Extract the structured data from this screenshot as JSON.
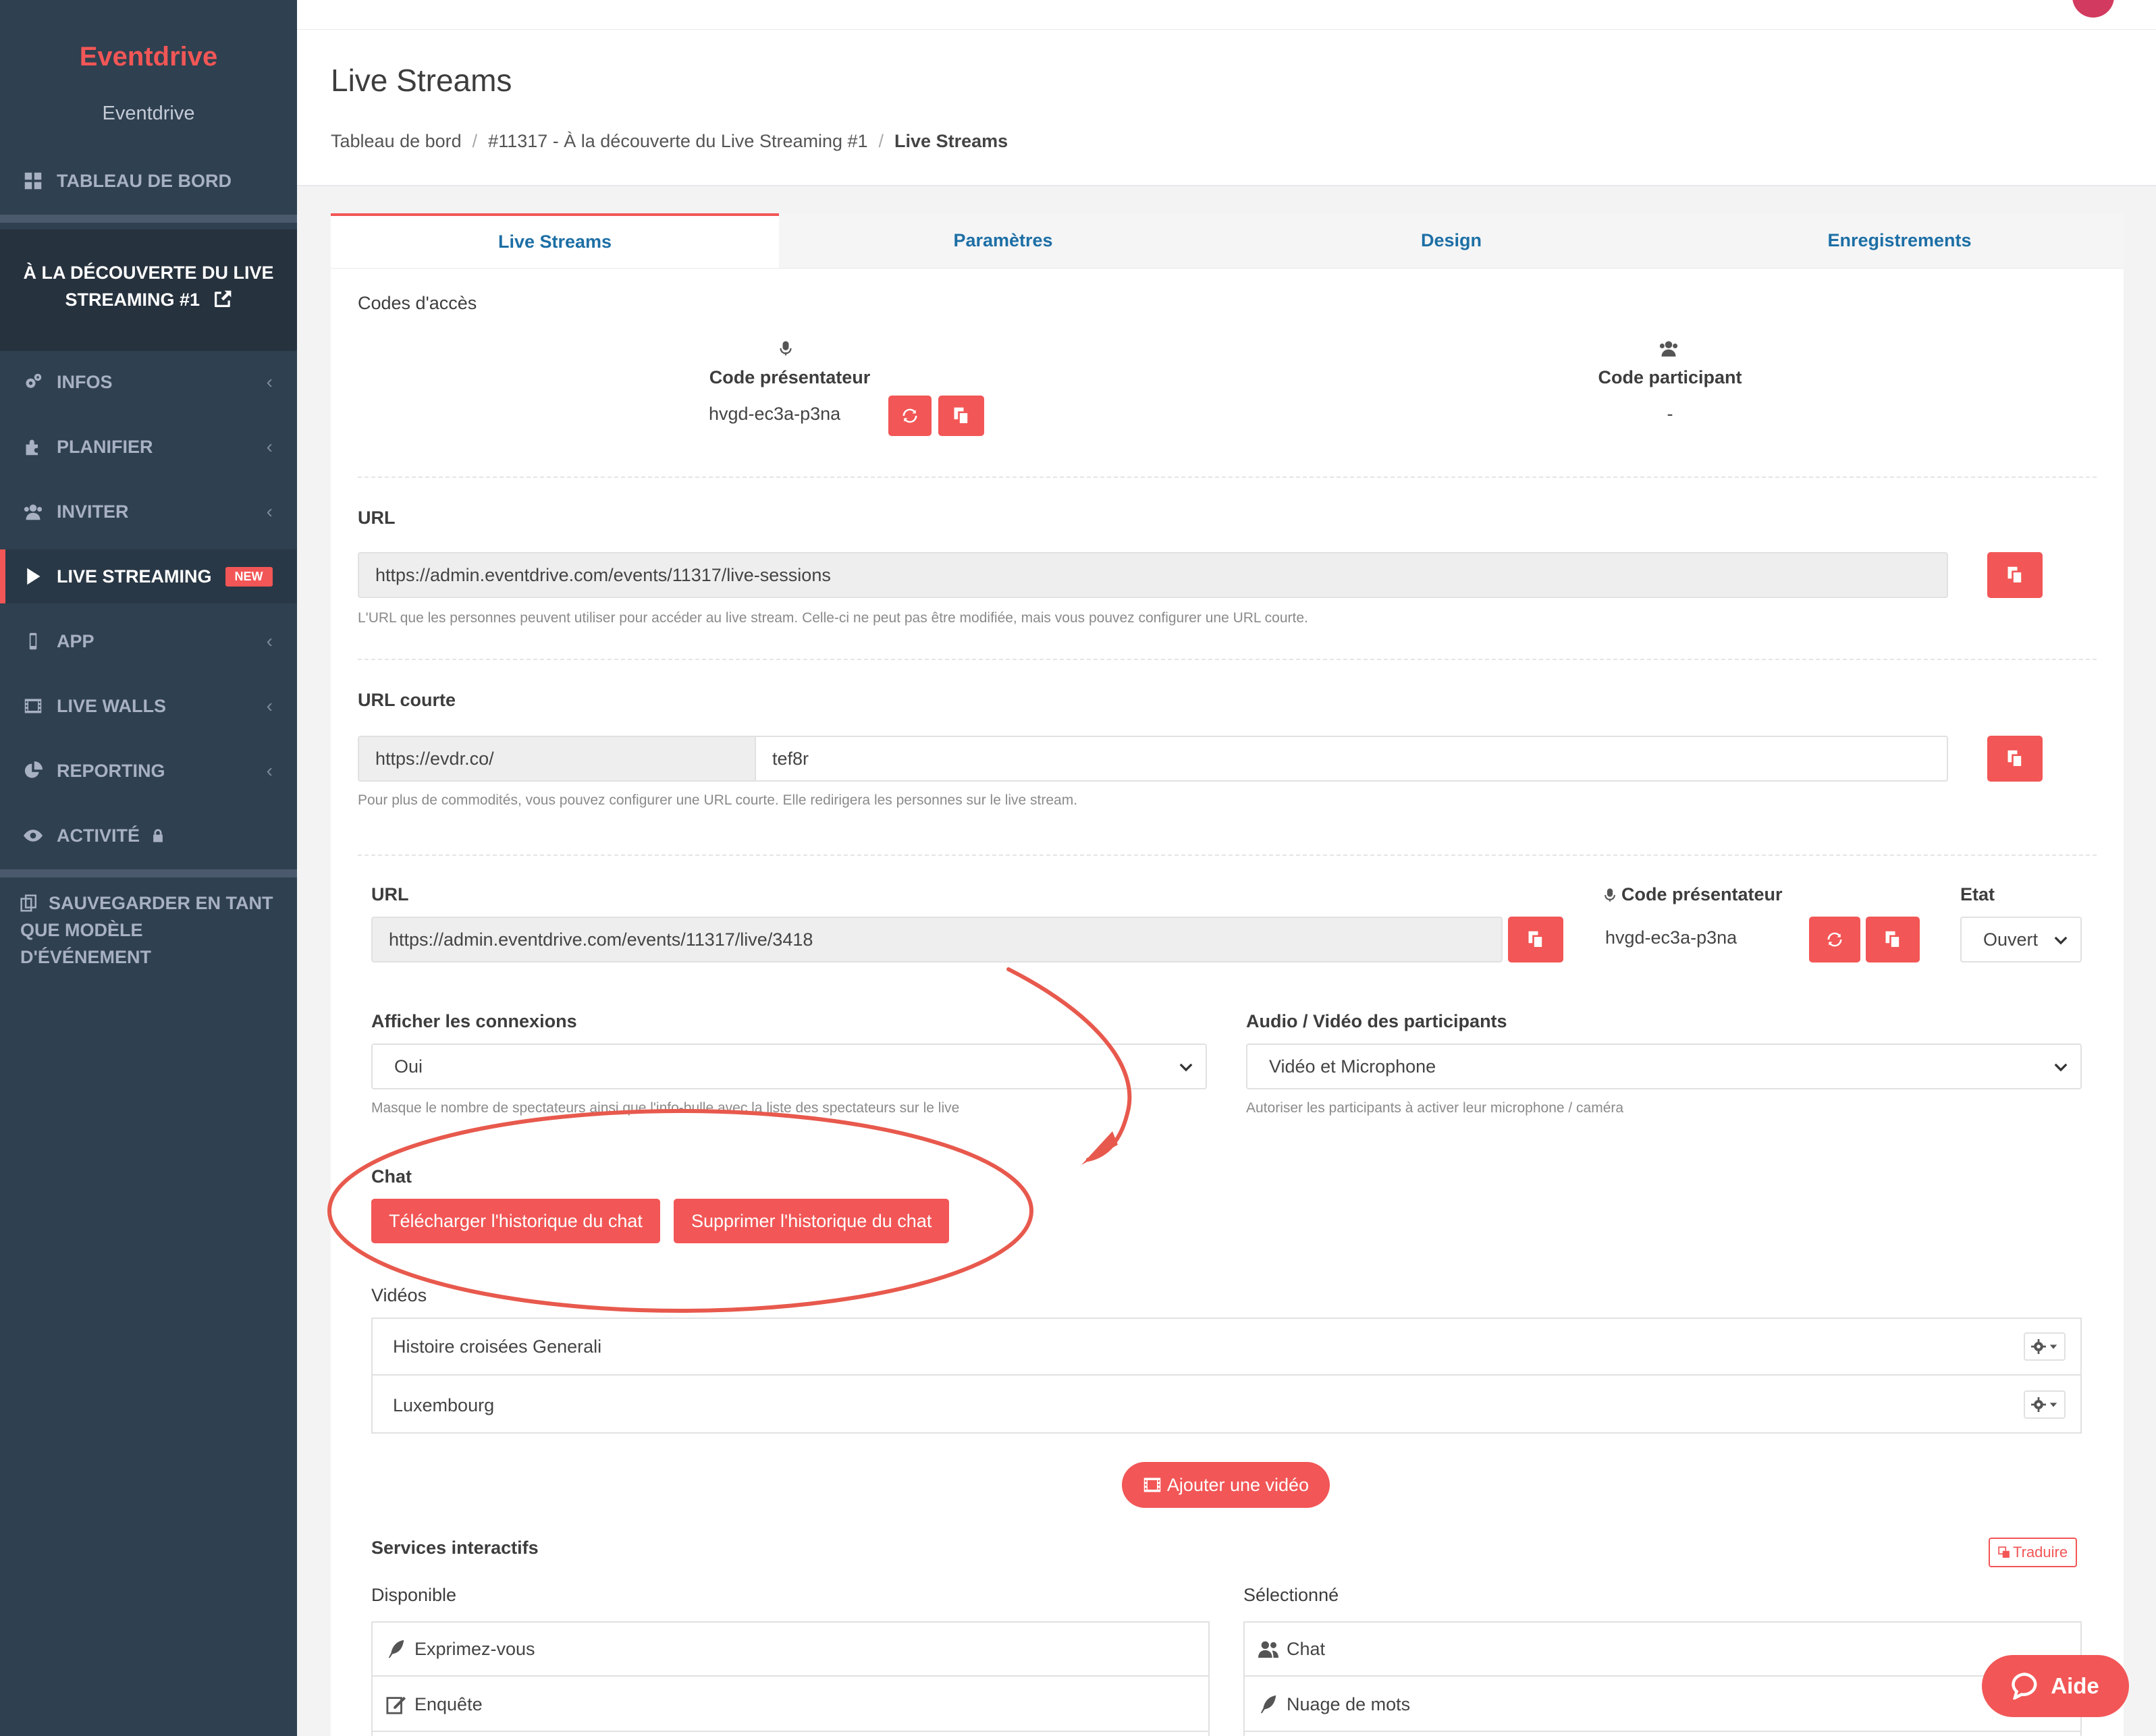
{
  "sidebar": {
    "brand": "Eventdrive",
    "org_name": "Eventdrive",
    "dashboard": "TABLEAU DE BORD",
    "event_title_line1": "À LA DÉCOUVERTE DU LIVE",
    "event_title_line2": "STREAMING #1",
    "items": [
      {
        "label": "INFOS",
        "icon": "cogs-icon"
      },
      {
        "label": "PLANIFIER",
        "icon": "puzzle-icon"
      },
      {
        "label": "INVITER",
        "icon": "users-icon"
      },
      {
        "label": "LIVE STREAMING",
        "icon": "play-icon",
        "badge": "NEW"
      },
      {
        "label": "APP",
        "icon": "mobile-icon"
      },
      {
        "label": "LIVE WALLS",
        "icon": "film-icon"
      },
      {
        "label": "REPORTING",
        "icon": "pie-chart-icon"
      },
      {
        "label": "ACTIVITÉ",
        "icon": "eye-icon"
      }
    ],
    "save_template_line1": "SAUVEGARDER EN TANT",
    "save_template_line2": "QUE MODÈLE D'ÉVÉNEMENT"
  },
  "header": {
    "title": "Live Streams",
    "breadcrumb": [
      "Tableau de bord",
      "#11317 - À la découverte du Live Streaming #1",
      "Live Streams"
    ]
  },
  "tabs": [
    "Live Streams",
    "Paramètres",
    "Design",
    "Enregistrements"
  ],
  "access_codes": {
    "section_label": "Codes d'accès",
    "presenter_label": "Code présentateur",
    "presenter_code": "hvgd-ec3a-p3na",
    "participant_label": "Code participant",
    "participant_code": "-"
  },
  "url": {
    "label": "URL",
    "value": "https://admin.eventdrive.com/events/11317/live-sessions",
    "help": "L'URL que les personnes peuvent utiliser pour accéder au live stream. Celle-ci ne peut pas être modifiée, mais vous pouvez configurer une URL courte."
  },
  "short_url": {
    "label": "URL courte",
    "prefix": "https://evdr.co/",
    "value": "tef8r",
    "help": "Pour plus de commodités, vous pouvez configurer une URL courte. Elle redirigera les personnes sur le live stream."
  },
  "stream": {
    "url_label": "URL",
    "url_value": "https://admin.eventdrive.com/events/11317/live/3418",
    "presenter_label": "Code présentateur",
    "presenter_code": "hvgd-ec3a-p3na",
    "state_label": "Etat",
    "state_value": "Ouvert",
    "show_connections_label": "Afficher les connexions",
    "show_connections_value": "Oui",
    "show_connections_help": "Masque le nombre de spectateurs ainsi que l'info-bulle avec la liste des spectateurs sur le live",
    "av_label": "Audio / Vidéo des participants",
    "av_value": "Vidéo et Microphone",
    "av_help": "Autoriser les participants à activer leur microphone / caméra",
    "chat_label": "Chat",
    "chat_download": "Télécharger l'historique du chat",
    "chat_delete": "Supprimer l'historique du chat",
    "videos_label": "Vidéos",
    "videos": [
      "Histoire croisées Generali",
      "Luxembourg"
    ],
    "add_video": "Ajouter une vidéo"
  },
  "interactive": {
    "label": "Services interactifs",
    "translate": "Traduire",
    "available_label": "Disponible",
    "selected_label": "Sélectionné",
    "available": [
      {
        "label": "Exprimez-vous",
        "icon": "feather-icon"
      },
      {
        "label": "Enquête",
        "icon": "edit-icon"
      }
    ],
    "selected": [
      {
        "label": "Chat",
        "icon": "users-icon"
      },
      {
        "label": "Nuage de mots",
        "icon": "feather-icon"
      }
    ]
  },
  "help_button": "Aide",
  "colors": {
    "accent": "#f25656",
    "sidebar": "#2f4050",
    "link": "#1d6fa5",
    "annotation": "#e8594d"
  }
}
